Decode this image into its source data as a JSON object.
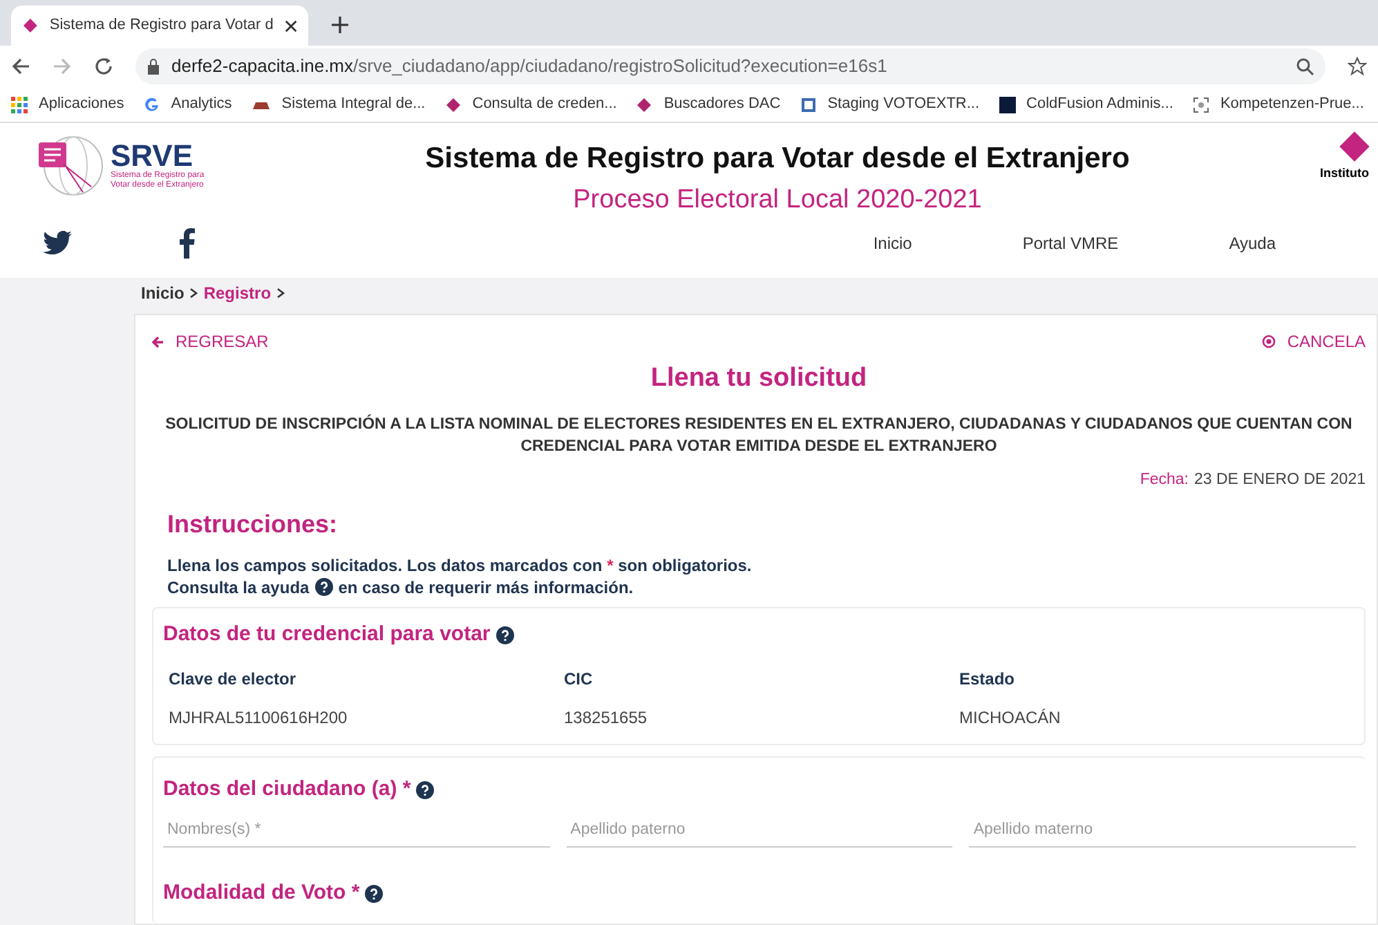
{
  "browser": {
    "tab_title": "Sistema de Registro para Votar d",
    "url_host": "derfe2-capacita.ine.mx",
    "url_path": "/srve_ciudadano/app/ciudadano/registroSolicitud?execution=e16s1",
    "bookmarks": [
      {
        "label": "Aplicaciones",
        "kind": "apps"
      },
      {
        "label": "Analytics",
        "kind": "google"
      },
      {
        "label": "Sistema Integral de...",
        "kind": "hat"
      },
      {
        "label": "Consulta de creden...",
        "kind": "ine"
      },
      {
        "label": "Buscadores DAC",
        "kind": "ine"
      },
      {
        "label": "Staging VOTOEXTR...",
        "kind": "doc"
      },
      {
        "label": "ColdFusion Adminis...",
        "kind": "cf"
      },
      {
        "label": "Kompetenzen-Prue...",
        "kind": "scan"
      }
    ]
  },
  "header": {
    "logo_text": "SRVE",
    "logo_caption": "Sistema de Registro para Votar desde el Extranjero",
    "title": "Sistema de Registro para Votar desde el Extranjero",
    "subtitle": "Proceso Electoral Local 2020-2021",
    "institute": "Instituto",
    "nav": [
      "Inicio",
      "Portal VMRE",
      "Ayuda"
    ]
  },
  "breadcrumb": [
    {
      "label": "Inicio",
      "selected": false
    },
    {
      "label": "Registro",
      "selected": true
    }
  ],
  "form": {
    "back": "REGRESAR",
    "cancel": "CANCELA",
    "heading": "Llena tu solicitud",
    "request_title": "SOLICITUD DE INSCRIPCIÓN A LA LISTA NOMINAL DE ELECTORES RESIDENTES EN EL EXTRANJERO, CIUDADANAS Y CIUDADANOS QUE CUENTAN CON CREDENCIAL PARA VOTAR EMITIDA DESDE EL EXTRANJERO",
    "date_label": "Fecha:",
    "date_value": "23 DE ENERO DE 2021",
    "instructions_heading": "Instrucciones:",
    "instructions_line1": [
      "Llena los campos solicitados. Los datos marcados con ",
      "*",
      " son obligatorios."
    ],
    "instructions_line2": [
      "Consulta la ayuda",
      "en caso de requerir más información."
    ],
    "credential": {
      "heading": "Datos de tu credencial para votar",
      "fields": [
        {
          "label": "Clave de elector",
          "value": "MJHRAL51100616H200"
        },
        {
          "label": "CIC",
          "value": "138251655"
        },
        {
          "label": "Estado",
          "value": "MICHOACÁN"
        }
      ]
    },
    "citizen": {
      "heading": "Datos del ciudadano (a)",
      "required": "*",
      "inputs": [
        {
          "placeholder": "Nombres(s) *"
        },
        {
          "placeholder": "Apellido paterno"
        },
        {
          "placeholder": "Apellido materno"
        }
      ]
    },
    "vote_mode": {
      "heading": "Modalidad de Voto",
      "required": "*"
    }
  }
}
